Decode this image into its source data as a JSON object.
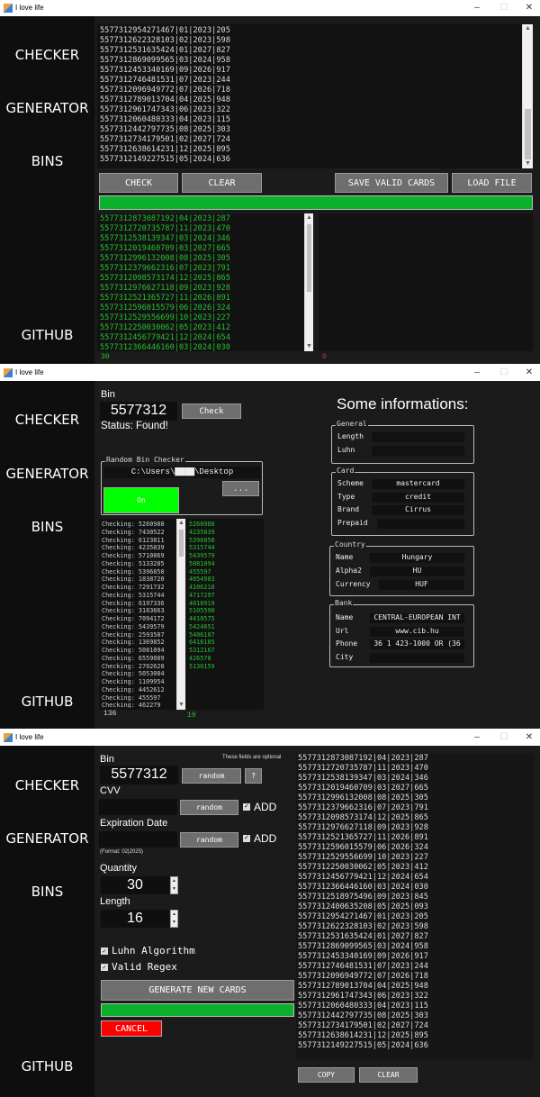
{
  "window_title": "I love life",
  "nav": {
    "checker": "CHECKER",
    "generator": "GENERATOR",
    "bins": "BINS",
    "github": "GITHUB"
  },
  "colors": {
    "progress": "#0db02b",
    "valid": "#22c32a",
    "invalid": "#e03030",
    "on_button": "#00ff00",
    "cancel": "#ff0000"
  },
  "checker": {
    "input_cards": [
      "5577312954271467|01|2023|205",
      "5577312622328103|02|2023|598",
      "5577312531635424|01|2027|827",
      "5577312869099565|03|2024|958",
      "5577312453340169|09|2026|917",
      "5577312746481531|07|2023|244",
      "5577312096949772|07|2026|718",
      "5577312789013704|04|2025|948",
      "5577312961747343|06|2023|322",
      "5577312060480333|04|2023|115",
      "5577312442797735|08|2025|303",
      "5577312734179501|02|2027|724",
      "5577312638614231|12|2025|895",
      "5577312149227515|05|2024|636"
    ],
    "buttons": {
      "check": "CHECK",
      "clear": "CLEAR",
      "save": "SAVE VALID CARDS",
      "load": "LOAD FILE"
    },
    "progress_percent": 100,
    "valid_cards": [
      "5577312873087192|04|2023|287",
      "5577312720735787|11|2023|470",
      "5577312538139347|03|2024|346",
      "5577312019460709|03|2027|665",
      "5577312996132008|08|2025|305",
      "5577312379662316|07|2023|791",
      "5577312098573174|12|2025|865",
      "5577312976627118|09|2023|928",
      "5577312521365727|11|2026|891",
      "5577312596015579|06|2026|324",
      "5577312529556699|10|2023|227",
      "5577312250030062|05|2023|412",
      "5577312456779421|12|2024|654",
      "5577312366446160|03|2024|030"
    ],
    "valid_count": "30",
    "invalid_count": "0"
  },
  "bins": {
    "bin_label": "Bin",
    "bin_value": "5577312",
    "check_button": "Check",
    "status": "Status: Found!",
    "random_group": "Random Bin Checker",
    "path": "C:\\Users\\▇▇▇▇\\Desktop",
    "on_button": "On",
    "browse_button": "...",
    "checking": [
      "Checking: 5260988",
      "Checking: 7430522",
      "Checking: 6123811",
      "Checking: 4235839",
      "Checking: 5710869",
      "Checking: 5133285",
      "Checking: 5396850",
      "Checking: 1838720",
      "Checking: 7291732",
      "Checking: 5315744",
      "Checking: 6197336",
      "Checking: 3183663",
      "Checking: 7094172",
      "Checking: 5439579",
      "Checking: 2593507",
      "Checking: 1369852",
      "Checking: 5081094",
      "Checking: 6559089",
      "Checking: 2702628",
      "Checking: 5053084",
      "Checking: 1109954",
      "Checking: 4452612",
      "Checking: 455597",
      "Checking: 462279"
    ],
    "found": [
      "5260988",
      "4235839",
      "5396850",
      "5315744",
      "5439579",
      "5081094",
      "455597",
      "4054983",
      "4106210",
      "4717297",
      "4018919",
      "5105590",
      "4410575",
      "5424651",
      "5406107",
      "6416185",
      "5312167",
      "426578",
      "5136159"
    ],
    "checked_count": "136",
    "found_count": "19",
    "info_title": "Some informations:",
    "general": {
      "label": "General",
      "length_label": "Length",
      "length": "",
      "luhn_label": "Luhn",
      "luhn": ""
    },
    "card": {
      "label": "Card",
      "scheme_label": "Scheme",
      "scheme": "mastercard",
      "type_label": "Type",
      "type": "credit",
      "brand_label": "Brand",
      "brand": "Cirrus",
      "prepaid_label": "Prepaid",
      "prepaid": ""
    },
    "country": {
      "label": "Country",
      "name_label": "Name",
      "name": "Hungary",
      "alpha2_label": "Alpha2",
      "alpha2": "HU",
      "currency_label": "Currency",
      "currency": "HUF"
    },
    "bank": {
      "label": "Bank",
      "name_label": "Name",
      "name": "CENTRAL-EUROPEAN INT",
      "url_label": "Url",
      "url": "www.cib.hu",
      "phone_label": "Phone",
      "phone": "36 1 423-1000 OR (36",
      "city_label": "City",
      "city": ""
    }
  },
  "generator": {
    "bin_label": "Bin",
    "bin_value": "5577312",
    "optional_note": "These fields are optional",
    "random": "random",
    "help": "?",
    "cvv_label": "CVV",
    "cvv_value": "",
    "exp_label": "Expiration Date",
    "exp_value": "",
    "add_label": "ADD",
    "cvv_add_checked": true,
    "exp_add_checked": true,
    "format_note": "(Format: 02|2025)",
    "quantity_label": "Quantity",
    "quantity": "30",
    "length_label": "Length",
    "length": "16",
    "luhn": "Luhn Algorithm",
    "luhn_checked": true,
    "regex": "Valid Regex",
    "regex_checked": true,
    "generate": "GENERATE NEW CARDS",
    "progress_percent": 100,
    "cancel": "CANCEL",
    "cards": [
      "5577312873087192|04|2023|287",
      "5577312720735787|11|2023|470",
      "5577312538139347|03|2024|346",
      "5577312019460709|03|2027|665",
      "5577312996132008|08|2025|305",
      "5577312379662316|07|2023|791",
      "5577312098573174|12|2025|865",
      "5577312976627118|09|2023|928",
      "5577312521365727|11|2026|891",
      "5577312596015579|06|2026|324",
      "5577312529556699|10|2023|227",
      "5577312250030062|05|2023|412",
      "5577312456779421|12|2024|654",
      "5577312366446160|03|2024|030",
      "5577312518975496|09|2023|845",
      "5577312400635208|05|2025|093",
      "5577312954271467|01|2023|205",
      "5577312622328103|02|2023|598",
      "5577312531635424|01|2027|827",
      "5577312869099565|03|2024|958",
      "5577312453340169|09|2026|917",
      "5577312746481531|07|2023|244",
      "5577312096949772|07|2026|718",
      "5577312789013704|04|2025|948",
      "5577312961747343|06|2023|322",
      "5577312060480333|04|2023|115",
      "5577312442797735|08|2025|303",
      "5577312734179501|02|2027|724",
      "5577312638614231|12|2025|895",
      "5577312149227515|05|2024|636"
    ],
    "copy": "COPY",
    "clear": "CLEAR"
  }
}
